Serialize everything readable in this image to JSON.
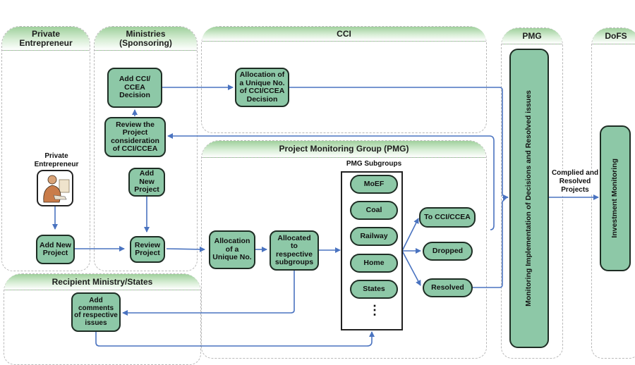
{
  "lanes": {
    "private": "Private Entrepreneur",
    "ministries": "Ministries (Sponsoring)",
    "cci": "CCI",
    "pmg_group": "Project Monitoring Group (PMG)",
    "pmg": "PMG",
    "dofs": "DoFS",
    "recipient": "Recipient Ministry/States"
  },
  "nodes": {
    "add_cci_decision": "Add CCI/ CCEA Decision",
    "allocation_cci_no": "Allocation of a Unique No. of CCI/CCEA Decision",
    "review_consideration": "Review the Project consideration of CCI/CCEA",
    "ministry_add_project": "Add New Project",
    "private_add_project": "Add New Project",
    "review_project": "Review Project",
    "allocation_unique_no": "Allocation of a Unique No.",
    "allocated_subgroups": "Allocated to respective subgroups",
    "to_cci": "To CCI/CCEA",
    "dropped": "Dropped",
    "resolved": "Resolved",
    "add_comments": "Add comments of respective issues",
    "monitoring": "Monitoring  Implementation of Decisions and  Resolved issues",
    "investment": "Investment Monitoring"
  },
  "labels": {
    "private_entrepreneur": "Private Entrepreneur",
    "pmg_subgroups": "PMG Subgroups",
    "complied": "Complied and Resolved Projects",
    "ellipsis": "⋮"
  },
  "subgroups": [
    "MoEF",
    "Coal",
    "Railway",
    "Home",
    "States"
  ],
  "colors": {
    "node_fill": "#8dc8a7",
    "arrow": "#4a73c0",
    "lane_header": "#9fd09c"
  }
}
